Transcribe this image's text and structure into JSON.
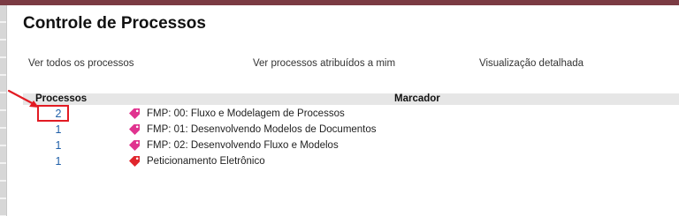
{
  "page": {
    "title": "Controle de Processos"
  },
  "views": [
    {
      "label": "Ver todos os processos"
    },
    {
      "label": "Ver processos atribuídos a mim"
    },
    {
      "label": "Visualização detalhada"
    }
  ],
  "table": {
    "headers": {
      "processos": "Processos",
      "marcador": "Marcador"
    },
    "rows": [
      {
        "count": "2",
        "label": "FMP: 00: Fluxo e Modelagem de Processos",
        "tag_color": "#e0338f"
      },
      {
        "count": "1",
        "label": "FMP: 01: Desenvolvendo Modelos de Documentos",
        "tag_color": "#e0338f"
      },
      {
        "count": "1",
        "label": "FMP: 02: Desenvolvendo Fluxo e Modelos",
        "tag_color": "#e0338f"
      },
      {
        "count": "1",
        "label": "Peticionamento Eletrônico",
        "tag_color": "#e0262d"
      }
    ]
  },
  "colors": {
    "top_bar": "#7b3b43",
    "link": "#1f5fa8",
    "annotation": "#e21b23"
  }
}
